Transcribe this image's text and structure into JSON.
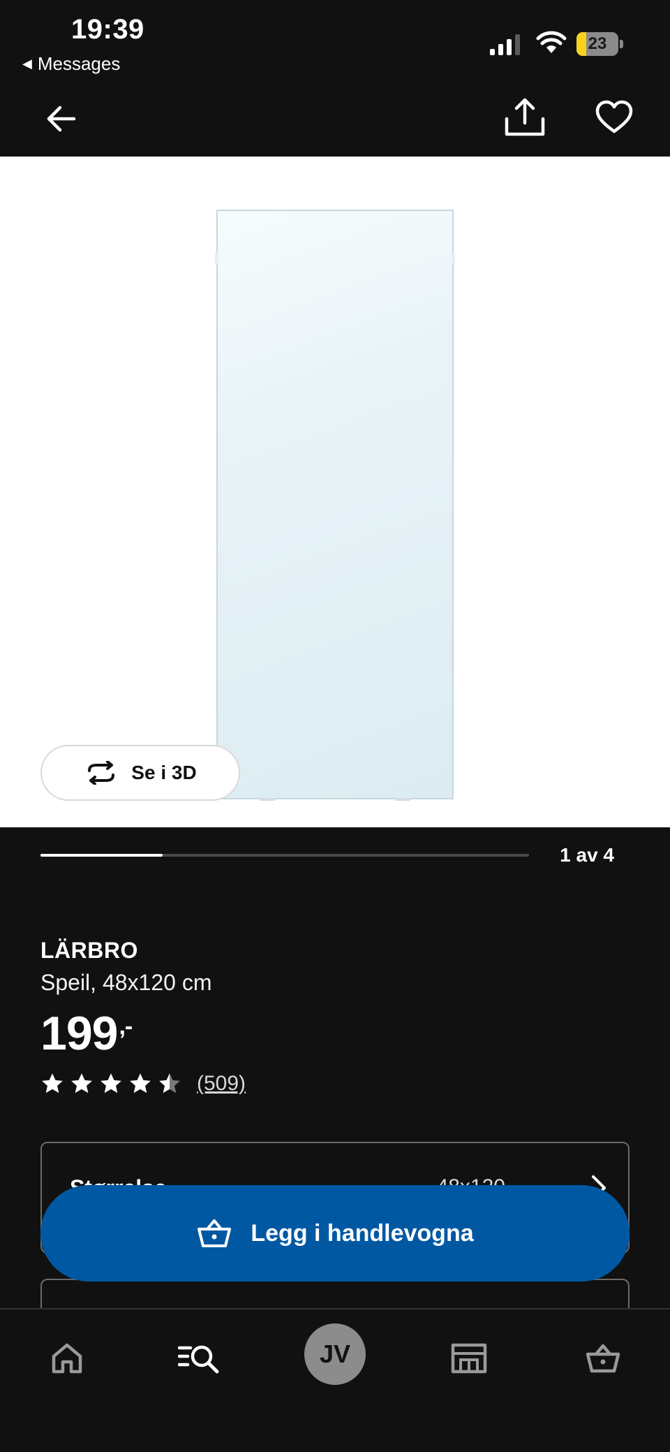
{
  "status": {
    "time": "19:39",
    "back_label": "Messages",
    "battery": "23"
  },
  "nav": {
    "back_icon": "arrow-left-icon",
    "share_icon": "share-icon",
    "favorite_icon": "heart-icon"
  },
  "hero": {
    "view_3d_label": "Se i 3D",
    "view_3d_icon": "rotate-icon"
  },
  "gallery": {
    "position_label": "1 av 4",
    "current": 1,
    "total": 4
  },
  "product": {
    "name": "LÄRBRO",
    "description": "Speil, 48x120 cm",
    "price": "199",
    "price_suffix": ",-",
    "rating": 4.5,
    "rating_max": 5,
    "review_count": "(509)"
  },
  "options": {
    "size_label": "Størrelse",
    "size_value": "48x120"
  },
  "cta": {
    "label": "Legg i handlevogna",
    "icon": "basket-icon"
  },
  "tabs": {
    "home_icon": "home-icon",
    "search_icon": "search-list-icon",
    "avatar_initials": "JV",
    "store_icon": "store-icon",
    "cart_icon": "basket-icon"
  },
  "colors": {
    "background": "#111111",
    "accent": "#0058a3",
    "battery": "#f7d31d"
  }
}
